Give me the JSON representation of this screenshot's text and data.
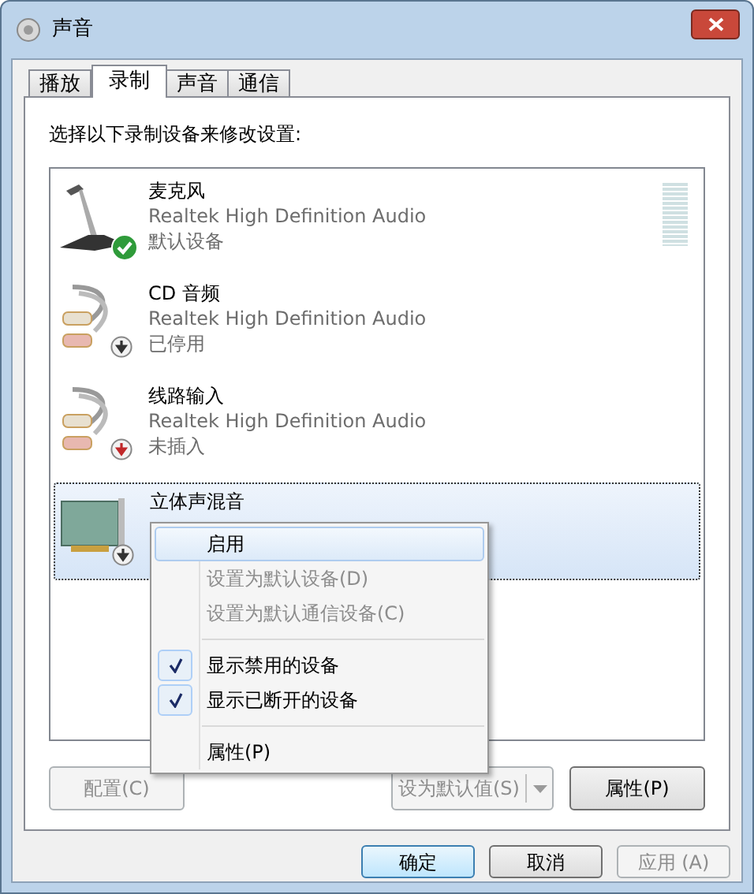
{
  "window": {
    "title": "声音"
  },
  "tabs": [
    {
      "label": "播放",
      "selected": false
    },
    {
      "label": "录制",
      "selected": true
    },
    {
      "label": "声音",
      "selected": false
    },
    {
      "label": "通信",
      "selected": false
    }
  ],
  "instruction": "选择以下录制设备来修改设置:",
  "devices": [
    {
      "name": "麦克风",
      "driver": "Realtek High Definition Audio",
      "status": "默认设备",
      "kind": "microphone",
      "is_default": true,
      "disabled": false,
      "unplugged": false,
      "selected": false,
      "level": 0
    },
    {
      "name": "CD 音频",
      "driver": "Realtek High Definition Audio",
      "status": "已停用",
      "kind": "cable",
      "is_default": false,
      "disabled": true,
      "unplugged": false,
      "selected": false
    },
    {
      "name": "线路输入",
      "driver": "Realtek High Definition Audio",
      "status": "未插入",
      "kind": "cable",
      "is_default": false,
      "disabled": false,
      "unplugged": true,
      "selected": false
    },
    {
      "name": "立体声混音",
      "kind": "card",
      "is_default": false,
      "disabled": true,
      "unplugged": false,
      "selected": true
    }
  ],
  "context_menu": [
    {
      "kind": "item",
      "label": "启用",
      "disabled": false,
      "checked": false,
      "selected": true
    },
    {
      "kind": "item",
      "label": "设置为默认设备(D)",
      "disabled": true,
      "checked": false,
      "selected": false
    },
    {
      "kind": "item",
      "label": "设置为默认通信设备(C)",
      "disabled": true,
      "checked": false,
      "selected": false
    },
    {
      "kind": "separator"
    },
    {
      "kind": "item",
      "label": "显示禁用的设备",
      "disabled": false,
      "checked": true,
      "selected": false
    },
    {
      "kind": "item",
      "label": "显示已断开的设备",
      "disabled": false,
      "checked": true,
      "selected": false
    },
    {
      "kind": "separator"
    },
    {
      "kind": "item",
      "label": "属性(P)",
      "disabled": false,
      "checked": false,
      "selected": false
    }
  ],
  "panel_buttons": [
    {
      "kind": "button",
      "label": "配置(C)",
      "disabled": true
    },
    {
      "kind": "split",
      "label": "设为默认值(S)",
      "disabled": true
    },
    {
      "kind": "button",
      "label": "属性(P)",
      "disabled": false
    }
  ],
  "dialog_buttons": [
    {
      "label": "确定",
      "disabled": false,
      "default": true
    },
    {
      "label": "取消",
      "disabled": false,
      "default": false
    },
    {
      "label": "应用 (A)",
      "disabled": true,
      "default": false
    }
  ]
}
